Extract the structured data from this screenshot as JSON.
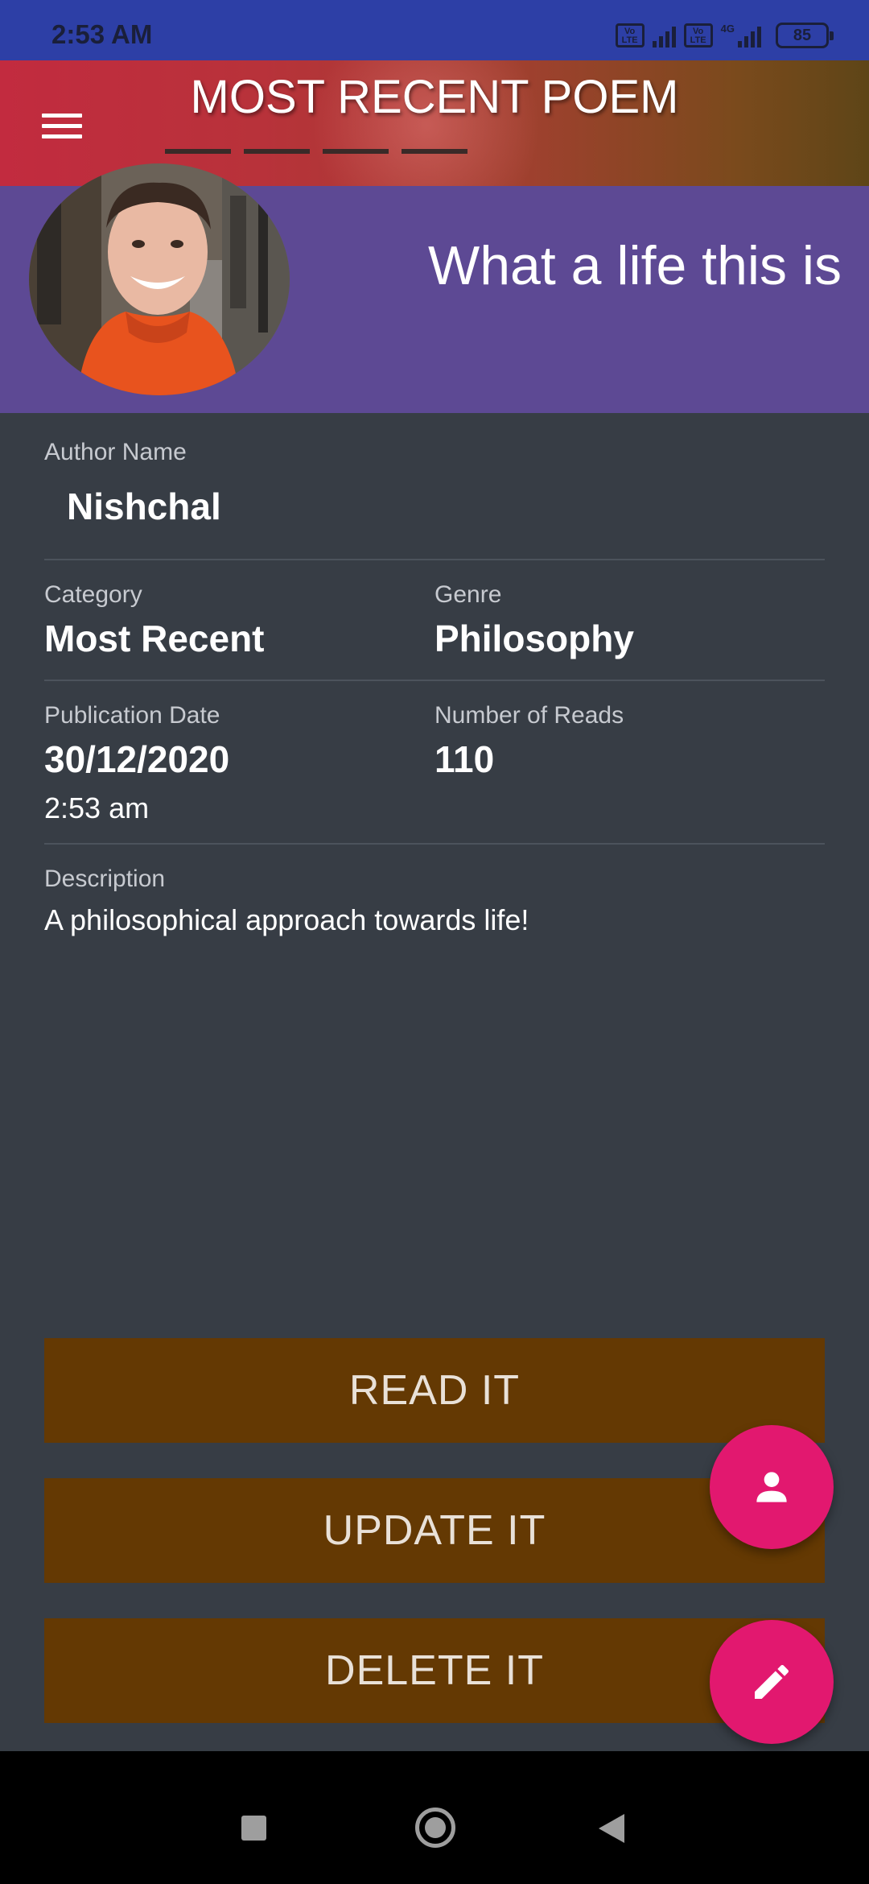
{
  "status_bar": {
    "time": "2:53 AM",
    "volte_label": "Vo LTE",
    "network_label": "4G",
    "battery": "85"
  },
  "header": {
    "title": "MOST RECENT POEM",
    "menu_icon": "hamburger-menu-icon",
    "tab_count": 4
  },
  "banner": {
    "poem_title": "What a life this is",
    "avatar": "author-photo"
  },
  "details": {
    "author_label": "Author Name",
    "author_value": "Nishchal",
    "category_label": "Category",
    "category_value": "Most Recent",
    "genre_label": "Genre",
    "genre_value": "Philosophy",
    "pub_date_label": "Publication Date",
    "pub_date_value": "30/12/2020",
    "pub_time_value": "2:53 am",
    "reads_label": "Number of Reads",
    "reads_value": "110",
    "description_label": "Description",
    "description_value": "A philosophical approach towards life!"
  },
  "actions": {
    "read": "READ IT",
    "update": "UPDATE IT",
    "delete": "DELETE IT"
  },
  "fabs": {
    "profile_icon": "person-icon",
    "edit_icon": "pencil-icon"
  },
  "nav": {
    "recents_icon": "square-icon",
    "home_icon": "circle-icon",
    "back_icon": "triangle-back-icon"
  },
  "colors": {
    "status_bar": "#2d3fa6",
    "banner": "#5d4994",
    "background": "#373d45",
    "button": "#643903",
    "fab": "#e2186f"
  }
}
